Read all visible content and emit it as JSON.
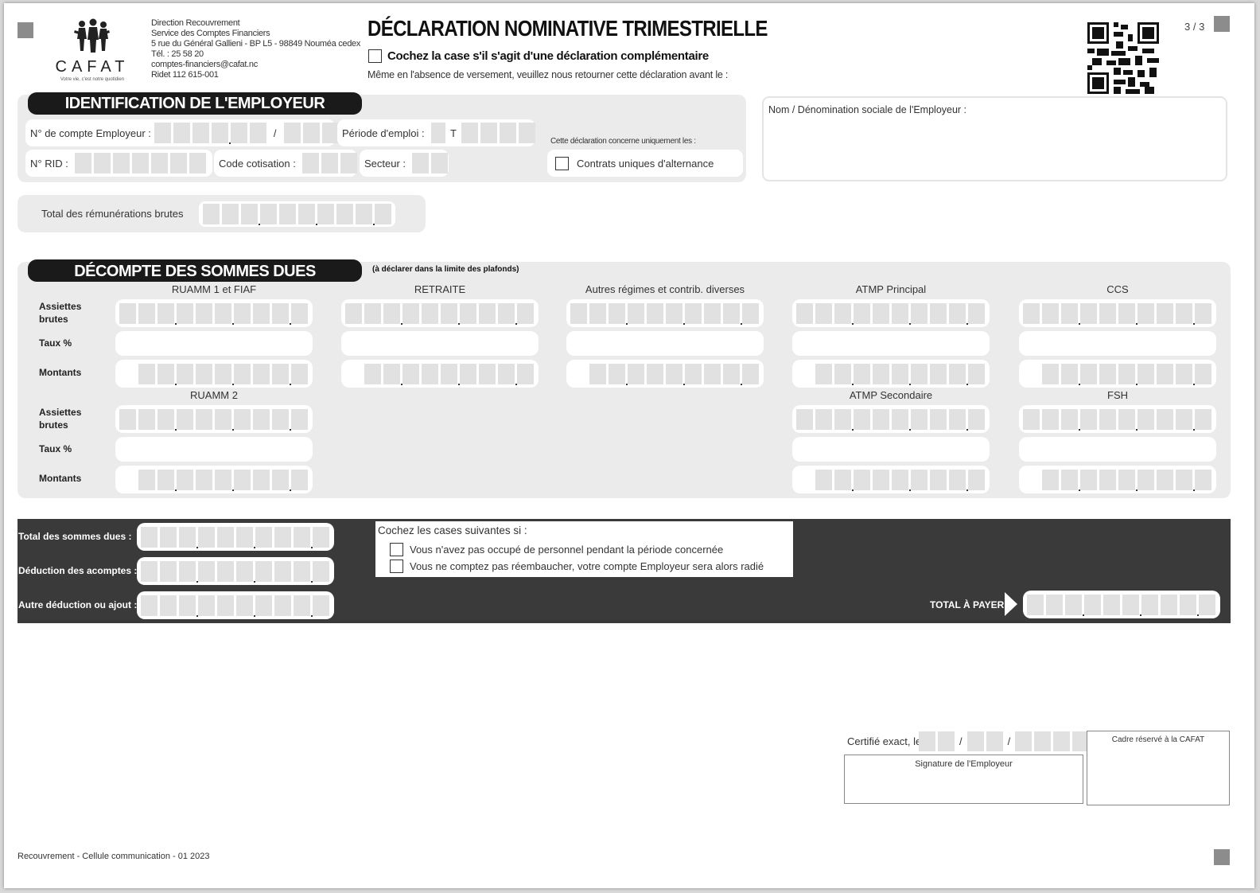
{
  "page_indicator": "3 / 3",
  "org": {
    "name": "CAFAT",
    "tagline": "Votre vie, c'est notre quotidien",
    "address_lines": [
      "Direction Recouvrement",
      "Service des Comptes Financiers",
      "5 rue du Général Gallieni - BP L5 - 98849 Nouméa cedex",
      "Tél. : 25 58 20",
      "comptes-financiers@cafat.nc",
      "Ridet 112 615-001"
    ]
  },
  "title": "DÉCLARATION NOMINATIVE TRIMESTRIELLE",
  "complementary_checkbox_label": "Cochez la case s'il s'agit d'une déclaration complémentaire",
  "instruction": "Même en l'absence de versement, veuillez nous retourner cette déclaration avant le :",
  "employer_section": {
    "header": "IDENTIFICATION DE L'EMPLOYEUR",
    "account_label": "N° de compte Employeur :",
    "account_separator": "/",
    "period_label": "Période d'emploi :",
    "period_prefix": "T",
    "rid_label": "N° RID :",
    "cotisation_label": "Code cotisation :",
    "sector_label": "Secteur :",
    "concerns_label": "Cette déclaration concerne uniquement les :",
    "alternance_label": "Contrats uniques d'alternance",
    "employer_name_label": "Nom / Dénomination sociale de l'Employeur :",
    "total_remun_label": "Total des rémunérations brutes"
  },
  "decompte": {
    "header": "DÉCOMPTE DES SOMMES DUES",
    "note": "(à déclarer dans la limite des plafonds)",
    "row_labels": {
      "assiettes": "Assiettes brutes",
      "taux": "Taux %",
      "montants": "Montants"
    },
    "columns_top": [
      "RUAMM 1 et FIAF",
      "RETRAITE",
      "Autres régimes et contrib. diverses",
      "ATMP Principal",
      "CCS"
    ],
    "columns_bottom": [
      "RUAMM 2",
      "ATMP Secondaire",
      "FSH"
    ]
  },
  "totals": {
    "total_due_label": "Total des sommes dues :",
    "acomptes_label": "Déduction des acomptes :",
    "other_label": "Autre déduction ou ajout :",
    "check_intro": "Cochez les cases suivantes si :",
    "check_no_staff": "Vous n'avez pas occupé de personnel pendant la période concernée",
    "check_no_rehire": "Vous ne comptez pas réembaucher, votre compte Employeur sera alors radié",
    "total_to_pay_label": "TOTAL À PAYER"
  },
  "signature": {
    "certified_label": "Certifié exact, le",
    "date_sep": "/",
    "signature_label": "Signature de l'Employeur",
    "reserved_label": "Cadre réservé à la CAFAT"
  },
  "footer": "Recouvrement - Cellule communication - 01 2023"
}
